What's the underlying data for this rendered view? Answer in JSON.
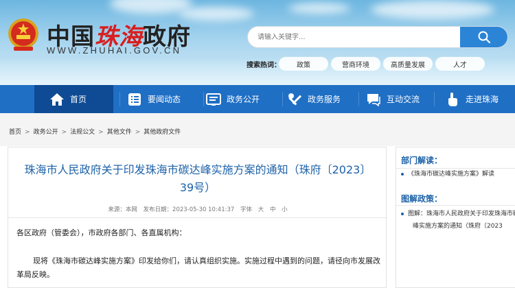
{
  "header": {
    "title_part1": "中国",
    "title_part2": "珠海",
    "title_part3": "政府",
    "url": "WWW.ZHUHAI.GOV.CN",
    "search_placeholder": "请输入关键字...",
    "hot_label": "搜索热词：",
    "hot_tags": [
      "政策",
      "营商环境",
      "高质量发展",
      "人才"
    ]
  },
  "nav": {
    "items": [
      "首页",
      "要闻动态",
      "政务公开",
      "政务服务",
      "互动交流",
      "走进珠海"
    ]
  },
  "breadcrumb": [
    "首页",
    "政务公开",
    "法规公文",
    "其他文件",
    "其他政府文件"
  ],
  "article": {
    "title_line1": "珠海市人民政府关于印发珠海市碳达峰实施方案的通知（珠府〔2023〕",
    "title_line2": "39号）",
    "source": "来源：本网",
    "date": "发布日期：2023-05-30 10:41:37",
    "font_label": "字体",
    "font_large": "大",
    "font_medium": "中",
    "font_small": "小",
    "salutation": "各区政府（管委会），市政府各部门、各直属机构：",
    "body": "现将《珠海市碳达峰实施方案》印发给你们，请认真组织实施。实施过程中遇到的问题，请径向市发展改革局反映。"
  },
  "sidebar": {
    "dept_heading": "部门解读：",
    "dept_item": "《珠海市碳达峰实施方案》解读",
    "graphic_heading": "图解政策：",
    "graphic_item_line1": "图解：珠海市人民政府关于印发珠海市碳达",
    "graphic_item_line2": "峰实施方案的通知（珠府〔2023"
  },
  "colors": {
    "nav_bg": "#1f6fc5",
    "nav_active": "#0e4b94",
    "title_blue": "#1d62a8",
    "logo_red": "#d81e1e"
  }
}
